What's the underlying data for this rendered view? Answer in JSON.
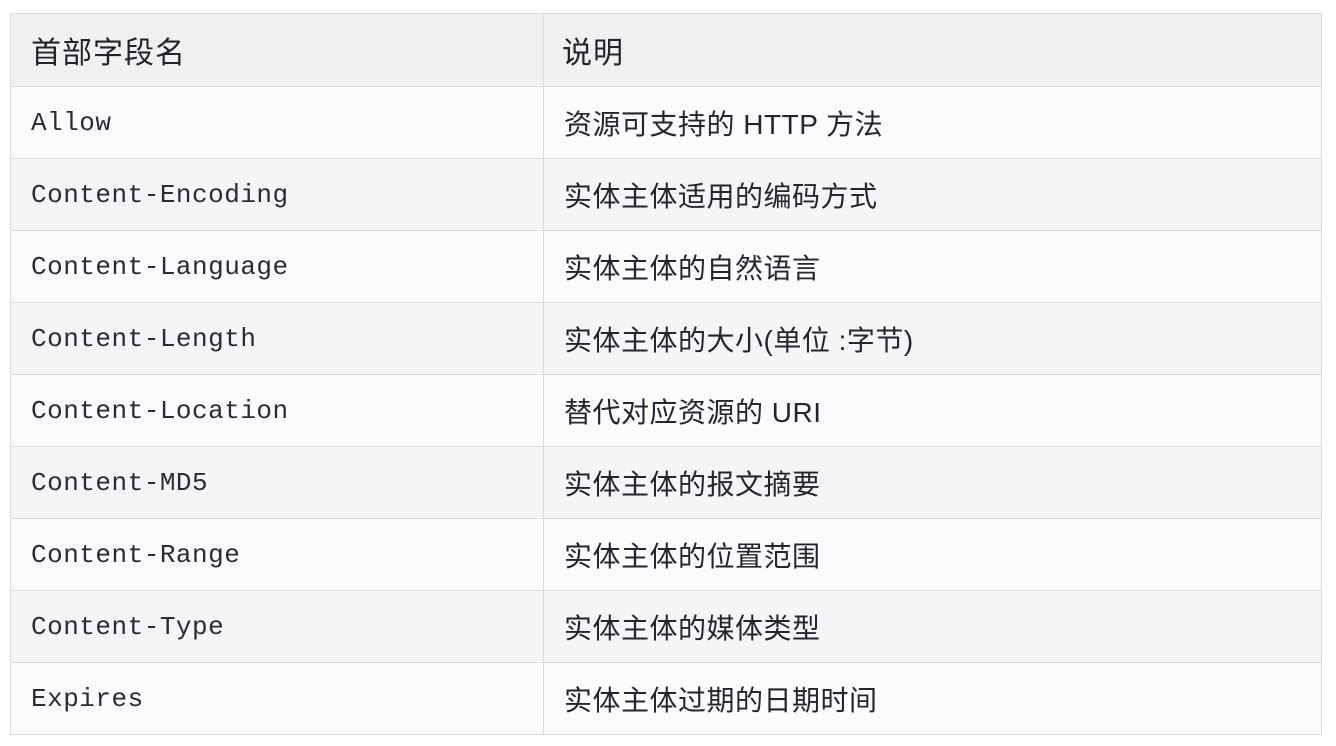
{
  "table": {
    "columns": [
      {
        "key": "field",
        "label": "首部字段名"
      },
      {
        "key": "description",
        "label": "说明"
      }
    ],
    "rows": [
      {
        "field": "Allow",
        "description": "资源可支持的 HTTP 方法"
      },
      {
        "field": "Content-Encoding",
        "description": "实体主体适用的编码方式"
      },
      {
        "field": "Content-Language",
        "description": "实体主体的自然语言"
      },
      {
        "field": "Content-Length",
        "description": "实体主体的大小(单位 :字节)"
      },
      {
        "field": "Content-Location",
        "description": "替代对应资源的 URI"
      },
      {
        "field": "Content-MD5",
        "description": "实体主体的报文摘要"
      },
      {
        "field": "Content-Range",
        "description": "实体主体的位置范围"
      },
      {
        "field": "Content-Type",
        "description": "实体主体的媒体类型"
      },
      {
        "field": "Expires",
        "description": "实体主体过期的日期时间"
      }
    ]
  },
  "colors": {
    "header_background": "#f1f0f1",
    "row_odd_background": "#fbfafc",
    "row_even_background": "#f5f4f7",
    "border": "#dcdade",
    "header_text": "#24222b",
    "field_text": "#2c2a33",
    "description_text": "#26242d",
    "page_background": "#ffffff"
  }
}
